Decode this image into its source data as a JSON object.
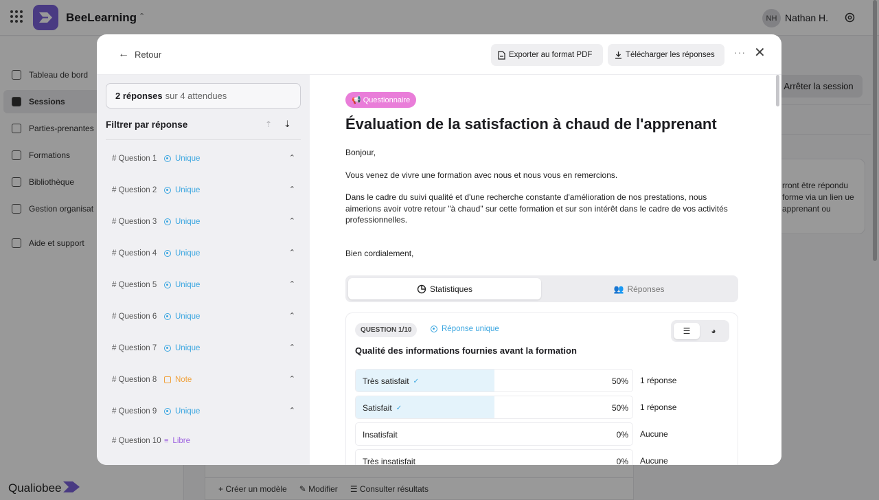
{
  "app": {
    "name": "BeeLearning",
    "user_initials": "NH",
    "user_name": "Nathan H.",
    "brand_footer": "Qualiobee"
  },
  "sidebar": {
    "items": [
      {
        "label": "Tableau de bord"
      },
      {
        "label": "Sessions"
      },
      {
        "label": "Parties-prenantes"
      },
      {
        "label": "Formations"
      },
      {
        "label": "Bibliothèque"
      },
      {
        "label": "Gestion organisat"
      },
      {
        "label": "Aide et support"
      }
    ]
  },
  "background": {
    "stop_session": "Arrêter la session",
    "info_text": "rront être répondu forme via un lien ue apprenant ou",
    "actions": [
      "Créer un modèle",
      "Modifier",
      "Consulter résultats"
    ]
  },
  "modal": {
    "back_label": "Retour",
    "export_pdf": "Exporter au format PDF",
    "download": "Télécharger les réponses",
    "more": "···",
    "close": "✕"
  },
  "left": {
    "responses_count": "2 réponses",
    "responses_expected": "sur 4 attendues",
    "filter_title": "Filtrer par réponse",
    "questions": [
      {
        "label": "# Question 1",
        "type": "Unique"
      },
      {
        "label": "# Question 2",
        "type": "Unique"
      },
      {
        "label": "# Question 3",
        "type": "Unique"
      },
      {
        "label": "# Question 4",
        "type": "Unique"
      },
      {
        "label": "# Question 5",
        "type": "Unique"
      },
      {
        "label": "# Question 6",
        "type": "Unique"
      },
      {
        "label": "# Question 7",
        "type": "Unique"
      },
      {
        "label": "# Question 8",
        "type": "Note"
      },
      {
        "label": "# Question 9",
        "type": "Unique"
      },
      {
        "label": "# Question 10",
        "type": "Libre"
      }
    ]
  },
  "form": {
    "badge": "Questionnaire",
    "title": "Évaluation de la satisfaction à chaud de l'apprenant",
    "intro": [
      "Bonjour,",
      "Vous venez de vivre une formation avec nous et nous vous en remercions.",
      "Dans le cadre du suivi qualité et d'une recherche constante d'amélioration de nos prestations, nous aimerions avoir votre retour \"à chaud\" sur cette formation et sur son intérêt dans le cadre de vos activités professionnelles.",
      "Bien cordialement,"
    ],
    "tabs": [
      {
        "label": "Statistiques"
      },
      {
        "label": "Réponses"
      }
    ]
  },
  "question": {
    "number": "QUESTION 1/10",
    "kind": "Réponse unique",
    "text": "Qualité des informations fournies avant la formation",
    "answers": [
      {
        "label": "Très satisfait",
        "checked": true,
        "percent": 50,
        "percent_label": "50%",
        "count": "1 réponse"
      },
      {
        "label": "Satisfait",
        "checked": true,
        "percent": 50,
        "percent_label": "50%",
        "count": "1 réponse"
      },
      {
        "label": "Insatisfait",
        "checked": false,
        "percent": 0,
        "percent_label": "0%",
        "count": "Aucune"
      },
      {
        "label": "Très insatisfait",
        "checked": false,
        "percent": 0,
        "percent_label": "0%",
        "count": "Aucune"
      }
    ]
  },
  "colors": {
    "brand": "#7b61d9",
    "badge": "#e97dd9",
    "unique": "#3ba6e0",
    "note": "#f0a23c",
    "libre": "#a066e0",
    "answer_fill": "#e4f3fb"
  },
  "icons": [
    "apps-grid-icon",
    "chevron-updown-icon",
    "gear-icon",
    "arrow-left-icon",
    "file-pdf-icon",
    "download-icon",
    "more-icon",
    "close-icon",
    "megaphone-icon",
    "pie-chart-icon",
    "users-icon",
    "bars-icon",
    "check-icon",
    "chevron-up-icon"
  ]
}
